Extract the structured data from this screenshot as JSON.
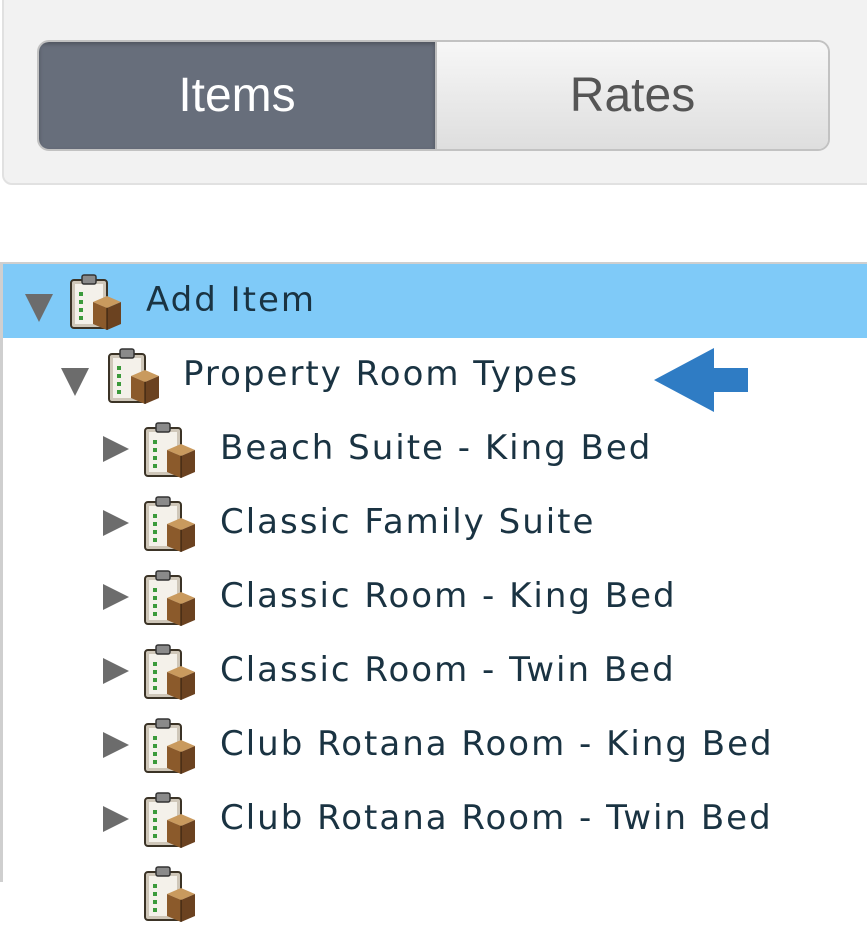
{
  "toggle_group": {
    "items_label": "Items",
    "rates_label": "Rates",
    "selected": "Items"
  },
  "tree": {
    "root": {
      "label": "Add Item",
      "expanded": true,
      "selected": true
    },
    "group": {
      "label": "Property Room Types",
      "expanded": true
    },
    "children": [
      {
        "label": "Beach Suite - King Bed"
      },
      {
        "label": "Classic Family Suite"
      },
      {
        "label": "Classic Room - King Bed"
      },
      {
        "label": "Classic Room - Twin Bed"
      },
      {
        "label": "Club Rotana Room - King Bed"
      },
      {
        "label": "Club Rotana Room - Twin Bed"
      }
    ]
  },
  "icons": {
    "node": "clipboard-box-icon",
    "annotation": "left-arrow-icon"
  },
  "colors": {
    "selected_row": "#7fcaf8",
    "active_toggle": "#676e7b",
    "annotation_arrow": "#2f7cc4",
    "label_text": "#1a3342"
  }
}
